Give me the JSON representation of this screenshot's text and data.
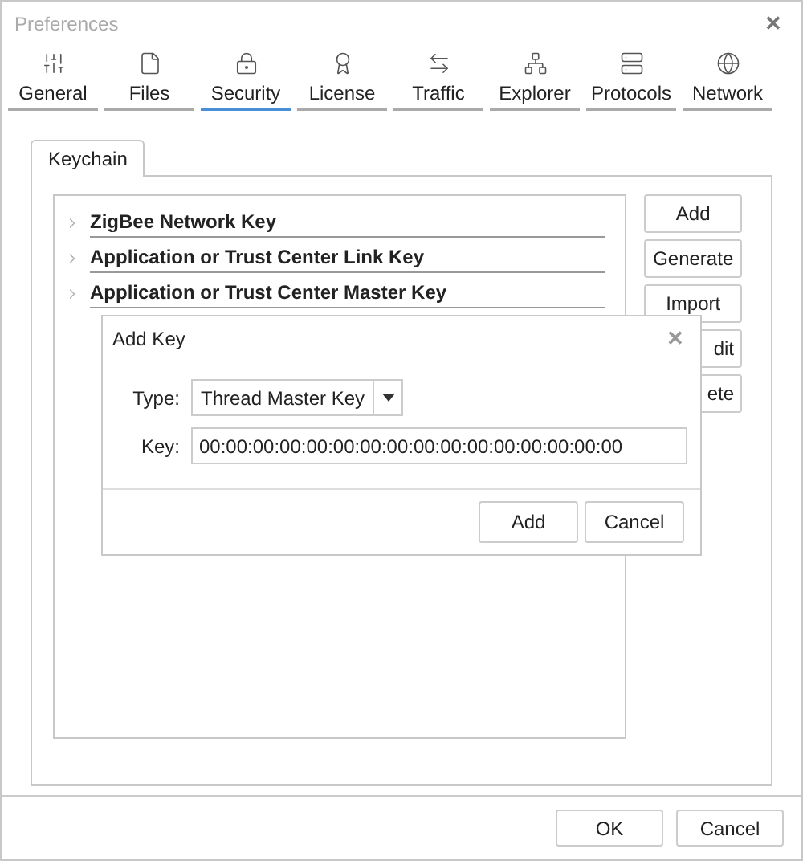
{
  "window": {
    "title": "Preferences",
    "close": "✕"
  },
  "tabs": [
    {
      "label": "General",
      "selected": false
    },
    {
      "label": "Files",
      "selected": false
    },
    {
      "label": "Security",
      "selected": true
    },
    {
      "label": "License",
      "selected": false
    },
    {
      "label": "Traffic",
      "selected": false
    },
    {
      "label": "Explorer",
      "selected": false
    },
    {
      "label": "Protocols",
      "selected": false
    },
    {
      "label": "Network",
      "selected": false
    }
  ],
  "subtabs": [
    {
      "label": "Keychain",
      "selected": true
    }
  ],
  "keys": [
    {
      "label": "ZigBee Network Key",
      "expanded": false
    },
    {
      "label": "Application or Trust Center Link Key",
      "expanded": false
    },
    {
      "label": "Application or Trust Center Master Key",
      "expanded": false
    }
  ],
  "side_buttons": [
    {
      "label": "Add",
      "partly_covered": false
    },
    {
      "label": "Generate",
      "partly_covered": false
    },
    {
      "label": "Import",
      "partly_covered": false
    },
    {
      "label": "dit",
      "partly_covered": true
    },
    {
      "label": "ete",
      "partly_covered": true
    }
  ],
  "dialog": {
    "title": "Add Key",
    "close": "✕",
    "type_label": "Type:",
    "type_value": "Thread Master Key",
    "key_label": "Key:",
    "key_value": "00:00:00:00:00:00:00:00:00:00:00:00:00:00:00:00",
    "buttons": [
      "Add",
      "Cancel"
    ]
  },
  "footer_buttons": [
    "OK",
    "Cancel"
  ]
}
